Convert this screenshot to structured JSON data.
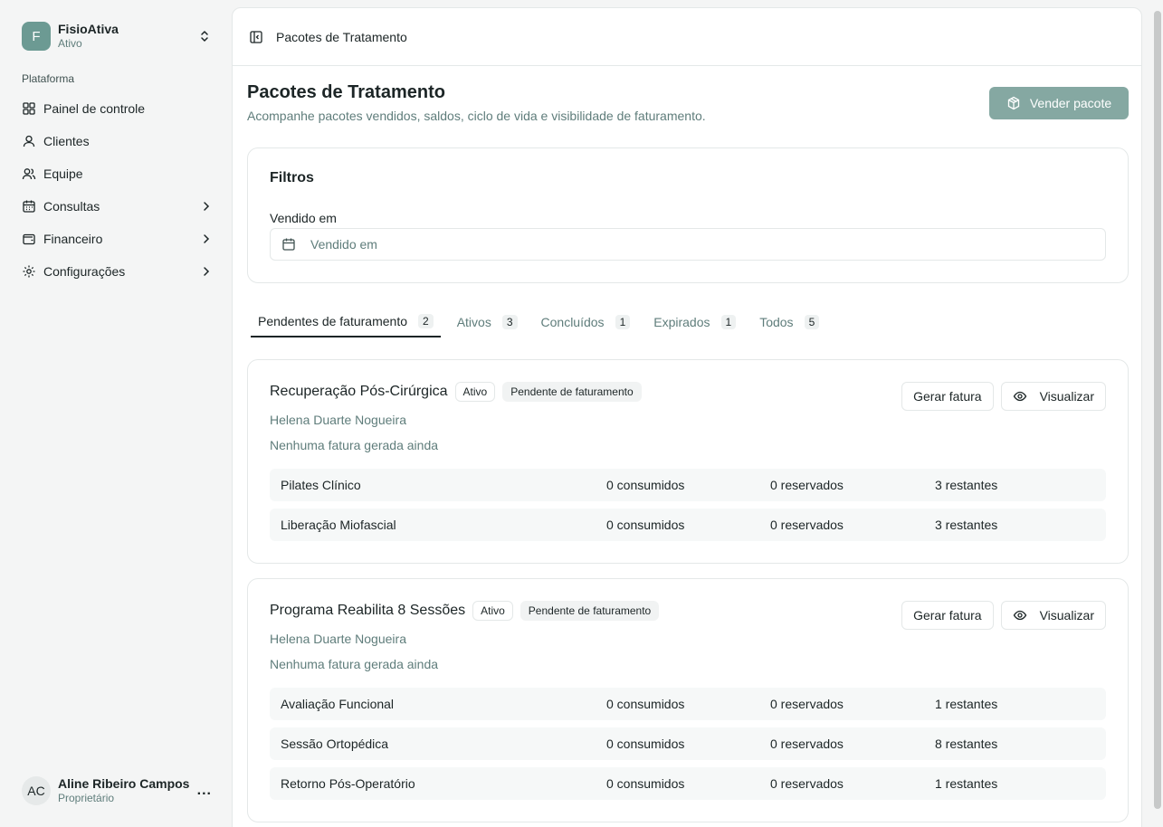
{
  "org": {
    "initial": "F",
    "name": "FisioAtiva",
    "status": "Ativo"
  },
  "sidebar": {
    "section": "Plataforma",
    "items": [
      {
        "label": "Painel de controle",
        "icon": "dashboard-icon",
        "expandable": false
      },
      {
        "label": "Clientes",
        "icon": "user-icon",
        "expandable": false
      },
      {
        "label": "Equipe",
        "icon": "users-icon",
        "expandable": false
      },
      {
        "label": "Consultas",
        "icon": "calendar-icon",
        "expandable": true
      },
      {
        "label": "Financeiro",
        "icon": "wallet-icon",
        "expandable": true
      },
      {
        "label": "Configurações",
        "icon": "gear-icon",
        "expandable": true
      }
    ]
  },
  "user": {
    "initials": "AC",
    "name": "Aline Ribeiro Campos",
    "role": "Proprietário",
    "more": "..."
  },
  "topbar": {
    "breadcrumb": "Pacotes de Tratamento"
  },
  "page": {
    "title": "Pacotes de Tratamento",
    "subtitle": "Acompanhe pacotes vendidos, saldos, ciclo de vida e visibilidade de faturamento.",
    "sell_button": "Vender pacote"
  },
  "filters": {
    "title": "Filtros",
    "sold_label": "Vendido em",
    "sold_placeholder": "Vendido em"
  },
  "tabs": [
    {
      "label": "Pendentes de faturamento",
      "count": "2",
      "active": true
    },
    {
      "label": "Ativos",
      "count": "3",
      "active": false
    },
    {
      "label": "Concluídos",
      "count": "1",
      "active": false
    },
    {
      "label": "Expirados",
      "count": "1",
      "active": false
    },
    {
      "label": "Todos",
      "count": "5",
      "active": false
    }
  ],
  "cards": [
    {
      "title": "Recuperação Pós-Cirúrgica",
      "badge_status": "Ativo",
      "badge_billing": "Pendente de faturamento",
      "client": "Helena Duarte Nogueira",
      "note": "Nenhuma fatura gerada ainda",
      "invoice_button": "Gerar fatura",
      "view_button": "Visualizar",
      "items": [
        {
          "name": "Pilates Clínico",
          "consumed": "0 consumidos",
          "reserved": "0 reservados",
          "remaining": "3 restantes"
        },
        {
          "name": "Liberação Miofascial",
          "consumed": "0 consumidos",
          "reserved": "0 reservados",
          "remaining": "3 restantes"
        }
      ]
    },
    {
      "title": "Programa Reabilita 8 Sessões",
      "badge_status": "Ativo",
      "badge_billing": "Pendente de faturamento",
      "client": "Helena Duarte Nogueira",
      "note": "Nenhuma fatura gerada ainda",
      "invoice_button": "Gerar fatura",
      "view_button": "Visualizar",
      "items": [
        {
          "name": "Avaliação Funcional",
          "consumed": "0 consumidos",
          "reserved": "0 reservados",
          "remaining": "1 restantes"
        },
        {
          "name": "Sessão Ortopédica",
          "consumed": "0 consumidos",
          "reserved": "0 reservados",
          "remaining": "8 restantes"
        },
        {
          "name": "Retorno Pós-Operatório",
          "consumed": "0 consumidos",
          "reserved": "0 reservados",
          "remaining": "1 restantes"
        }
      ]
    }
  ],
  "colors": {
    "accent": "#6c9a93",
    "button": "#85a8a2",
    "muted_text": "#5f7d7b"
  }
}
